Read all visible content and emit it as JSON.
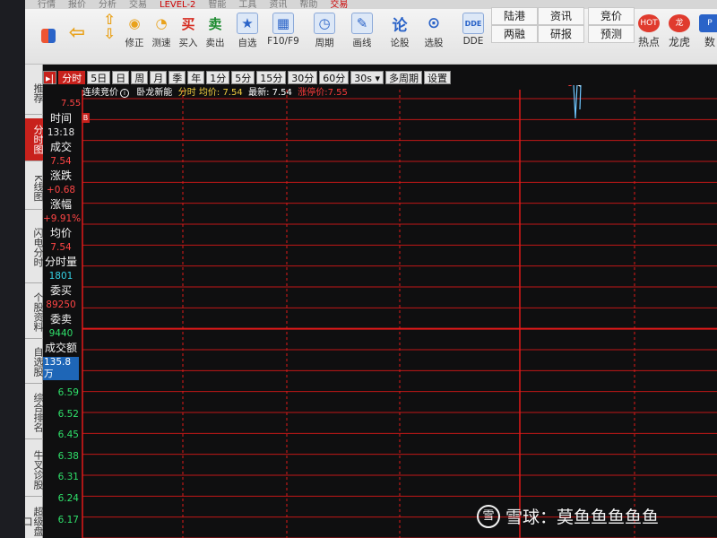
{
  "menubar": {
    "items": [
      "行情",
      "报价",
      "分析",
      "交易",
      "LEVEL-2",
      "智能",
      "工具",
      "资讯",
      "帮助",
      "交易"
    ]
  },
  "toolbar": {
    "buttons": [
      {
        "name": "back",
        "label": "",
        "glyph": "⇦",
        "color": "#e9a21b"
      },
      {
        "name": "forward",
        "label": "",
        "glyph": "⇩",
        "color": "#e9a21b"
      },
      {
        "name": "xiuzheng",
        "label": "修正",
        "glyph": "⇧",
        "color": "#e9a21b"
      },
      {
        "name": "cesu",
        "label": "测速",
        "glyph": "◔",
        "color": "#e9a21b"
      },
      {
        "name": "mairu",
        "label": "买入",
        "glyph": "买",
        "color": "#d62b20"
      },
      {
        "name": "maichu",
        "label": "卖出",
        "glyph": "卖",
        "color": "#1b8a2e"
      },
      {
        "name": "zixuan",
        "label": "自选",
        "glyph": "★",
        "color": "#2a63c8"
      },
      {
        "name": "f10",
        "label": "F10/F9",
        "glyph": "▦",
        "color": "#2a63c8"
      },
      {
        "name": "zhouqi",
        "label": "周期",
        "glyph": "◷",
        "color": "#2a63c8"
      },
      {
        "name": "huaxian",
        "label": "画线",
        "glyph": "✎",
        "color": "#2a63c8"
      },
      {
        "name": "lungu",
        "label": "论股",
        "glyph": "论",
        "color": "#2a63c8"
      },
      {
        "name": "xuangu",
        "label": "选股",
        "glyph": "⊙",
        "color": "#2a63c8"
      },
      {
        "name": "dde",
        "label": "DDE",
        "glyph": "DDE",
        "color": "#2a63c8"
      }
    ],
    "square_buttons": [
      "陆港",
      "资讯",
      "竞价",
      "两融",
      "研报",
      "预测"
    ],
    "hot": [
      {
        "name": "redian",
        "label": "热点",
        "badge": "HOT"
      },
      {
        "name": "longhu",
        "label": "龙虎",
        "badge": "龙"
      }
    ],
    "extra": "数"
  },
  "sidetabs": [
    "推荐",
    "分时图",
    "K线图",
    "闪电分时",
    "个股资料",
    "自选股",
    "综合排名",
    "牛叉诊股",
    "超级盘口"
  ],
  "periodbar": {
    "tabs": [
      "分时",
      "5日",
      "日",
      "周",
      "月",
      "季",
      "年",
      "1分",
      "5分",
      "15分",
      "30分",
      "60分",
      "30s",
      "多周期",
      "设置"
    ],
    "active": "分时"
  },
  "infoline": {
    "status": "连续竞价",
    "name": "卧龙新能",
    "avg_label": "分时 均价: 7.54",
    "latest_label": "最新: 7.54",
    "limit_label": "涨停价:7.55",
    "badge": "i"
  },
  "quote": {
    "time_label": "时间",
    "time_value": "13:18",
    "deal_label": "成交",
    "deal_value": "7.54",
    "change_label": "涨跌",
    "change_value": "+0.68",
    "pct_label": "涨幅",
    "pct_value": "+9.91%",
    "avg_label": "均价",
    "avg_value": "7.54",
    "vol_label": "分时量",
    "vol_value": "1801",
    "bid_label": "委买",
    "bid_value": "89250",
    "ask_label": "委卖",
    "ask_value": "9440",
    "amount_label": "成交额",
    "amount_value": "135.8万"
  },
  "chart": {
    "top_price": "7.55",
    "b_marker": "B",
    "price_labels": [
      "6.59",
      "6.52",
      "6.45",
      "6.38",
      "6.31",
      "6.24",
      "6.17"
    ],
    "line_color": "#e01919",
    "grid_color": "#e01919"
  },
  "chart_data": {
    "type": "line",
    "title": "卧龙新能",
    "y_ticks": [
      6.59,
      6.52,
      6.45,
      6.38,
      6.31,
      6.24,
      6.17
    ],
    "top_value": 7.55,
    "series": [
      {
        "name": "分时",
        "values": [
          7.55,
          7.55,
          7.55,
          7.54
        ]
      }
    ]
  },
  "watermark": {
    "logo": "雪",
    "text": "雪球：莫鱼鱼鱼鱼鱼"
  }
}
